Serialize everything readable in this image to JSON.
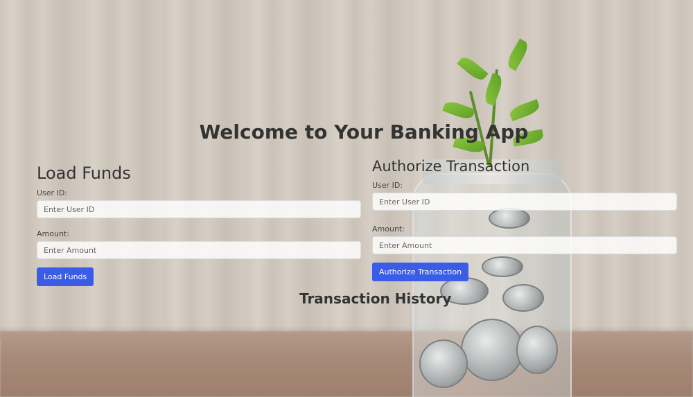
{
  "header": {
    "title": "Welcome to Your Banking App"
  },
  "load_funds": {
    "heading": "Load Funds",
    "user_id_label": "User ID:",
    "user_id_placeholder": "Enter User ID",
    "amount_label": "Amount:",
    "amount_placeholder": "Enter Amount",
    "button_label": "Load Funds"
  },
  "authorize": {
    "heading": "Authorize Transaction",
    "user_id_label": "User ID:",
    "user_id_placeholder": "Enter User ID",
    "amount_label": "Amount:",
    "amount_placeholder": "Enter Amount",
    "button_label": "Authorize Transaction"
  },
  "history": {
    "heading": "Transaction History"
  },
  "colors": {
    "accent": "#3a5ce6",
    "text": "#333333"
  }
}
